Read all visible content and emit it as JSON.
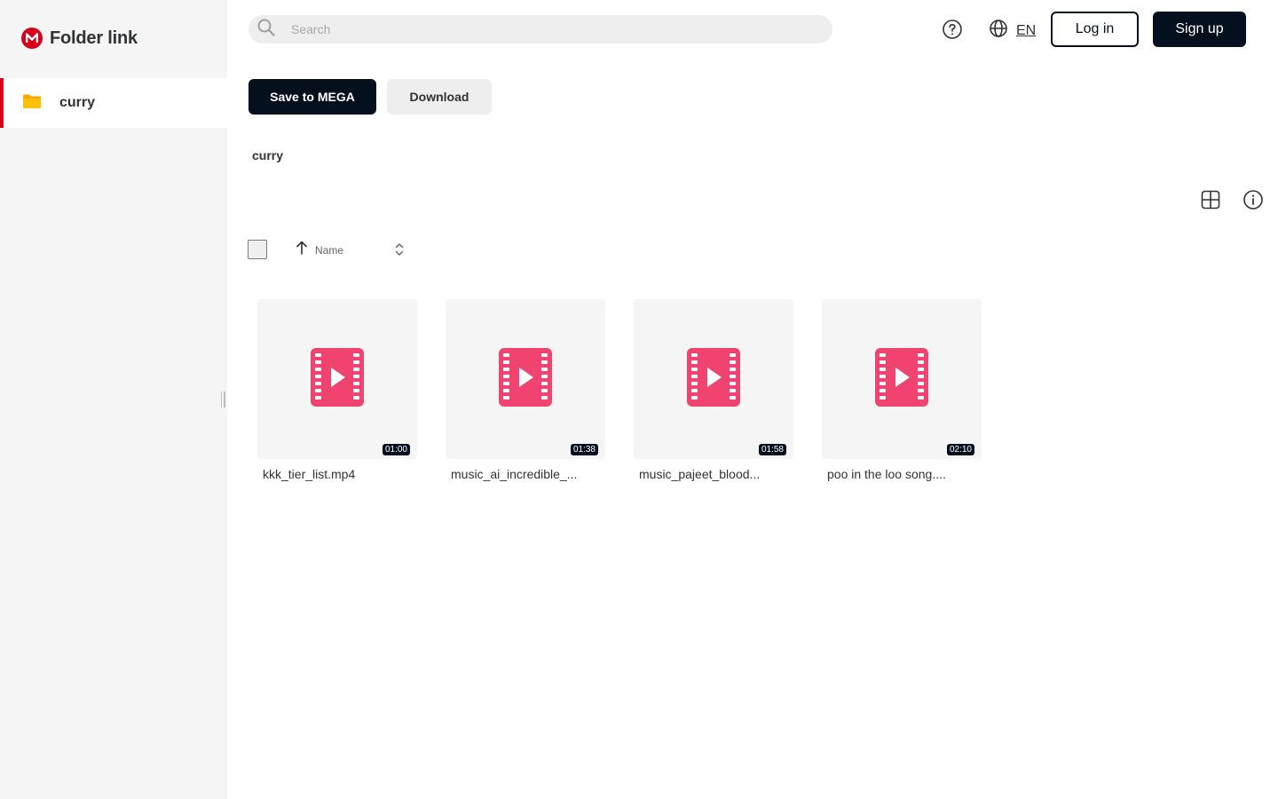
{
  "brand": {
    "title": "Folder link",
    "logo_letter": "M",
    "accent": "#d9001b"
  },
  "sidebar": {
    "items": [
      {
        "label": "curry",
        "icon": "folder-icon",
        "selected": true
      }
    ]
  },
  "header": {
    "search_placeholder": "Search",
    "language": "EN",
    "login_label": "Log in",
    "signup_label": "Sign up"
  },
  "actions": {
    "save_label": "Save to MEGA",
    "download_label": "Download"
  },
  "breadcrumb": "curry",
  "sort": {
    "label": "Name"
  },
  "files": [
    {
      "name": "kkk_tier_list.mp4",
      "duration": "01:00"
    },
    {
      "name": "music_ai_incredible_...",
      "duration": "01:38"
    },
    {
      "name": "music_pajeet_blood...",
      "duration": "01:58"
    },
    {
      "name": "poo in the loo song....",
      "duration": "02:10"
    }
  ],
  "colors": {
    "dark": "#04101e",
    "video_icon": "#f0436f"
  }
}
